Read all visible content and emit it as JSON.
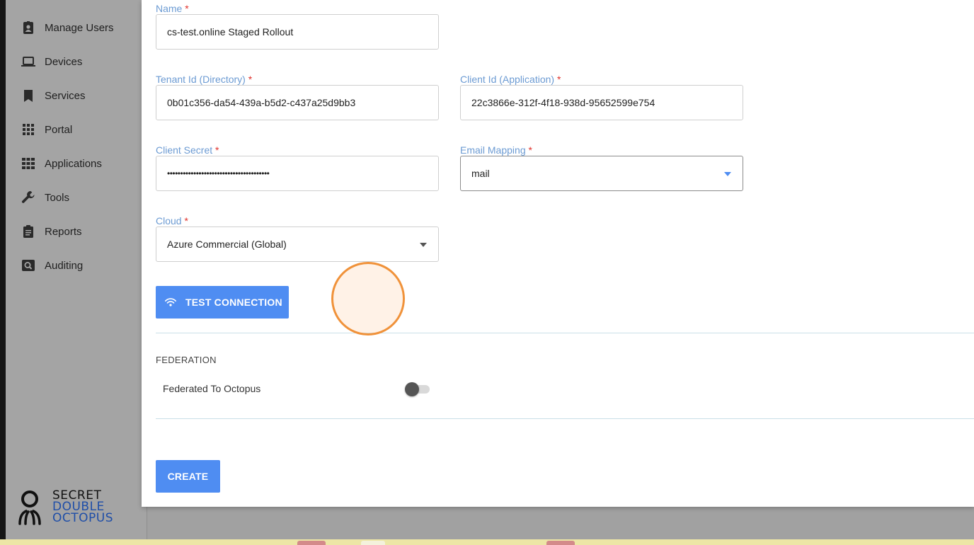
{
  "sidebar": {
    "items": [
      {
        "label": "Manage Users",
        "icon": "user-badge-icon"
      },
      {
        "label": "Devices",
        "icon": "laptop-icon"
      },
      {
        "label": "Services",
        "icon": "bookmark-icon"
      },
      {
        "label": "Portal",
        "icon": "grid-icon"
      },
      {
        "label": "Applications",
        "icon": "apps-grid-icon"
      },
      {
        "label": "Tools",
        "icon": "wrench-icon"
      },
      {
        "label": "Reports",
        "icon": "clipboard-icon"
      },
      {
        "label": "Auditing",
        "icon": "search-box-icon"
      }
    ],
    "logo": {
      "line1": "SECRET",
      "line2": "DOUBLE",
      "line3": "OCTOPUS"
    }
  },
  "form": {
    "name": {
      "label": "Name",
      "required": "*",
      "value": "cs-test.online Staged Rollout"
    },
    "tenant_id": {
      "label": "Tenant Id (Directory)",
      "required": "*",
      "value": "0b01c356-da54-439a-b5d2-c437a25d9bb3"
    },
    "client_id": {
      "label": "Client Id (Application)",
      "required": "*",
      "value": "22c3866e-312f-4f18-938d-95652599e754"
    },
    "client_secret": {
      "label": "Client Secret",
      "required": "*",
      "value": "•••••••••••••••••••••••••••••••••••••••"
    },
    "email_mapping": {
      "label": "Email Mapping",
      "required": "*",
      "value": "mail"
    },
    "cloud": {
      "label": "Cloud",
      "required": "*",
      "value": "Azure Commercial (Global)"
    },
    "test_connection_label": "TEST CONNECTION",
    "federation": {
      "title": "FEDERATION",
      "toggle_label": "Federated To Octopus",
      "enabled": false
    },
    "create_label": "CREATE"
  },
  "colors": {
    "accent": "#4f8df2",
    "label": "#6c9bd3",
    "required": "#e0312b",
    "cursor_ring": "#f0923a"
  }
}
